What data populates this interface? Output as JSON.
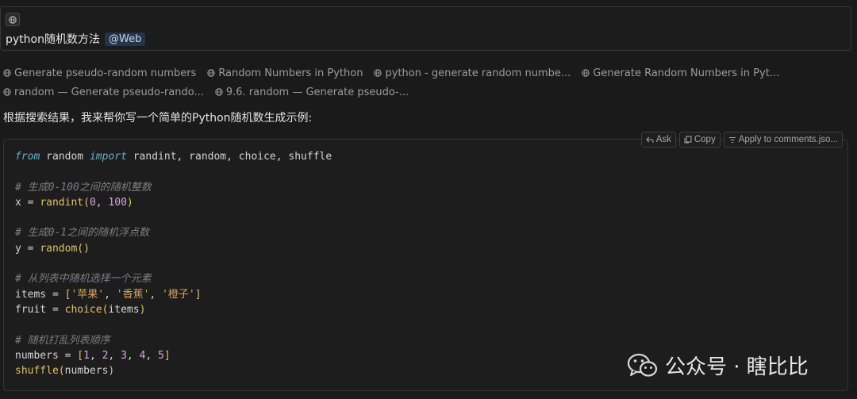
{
  "query": {
    "text": "python随机数方法",
    "tag": "@Web"
  },
  "sources": [
    [
      "Generate pseudo-random numbers",
      "Random Numbers in Python",
      "python - generate random numbe...",
      "Generate Random Numbers in Pyt..."
    ],
    [
      "random — Generate pseudo-rando...",
      "9.6. random — Generate pseudo-..."
    ]
  ],
  "answer_intro": "根据搜索结果，我来帮你写一个简单的Python随机数生成示例:",
  "code_actions": {
    "ask": "Ask",
    "copy": "Copy",
    "apply": "Apply to comments.jso..."
  },
  "code": {
    "l1": [
      "from",
      "random",
      "import",
      "randint, random, choice, shuffle"
    ],
    "c1": "# 生成0-100之间的随机整数",
    "l2": [
      "x = ",
      "randint",
      "(",
      "0",
      ", ",
      "100",
      ")"
    ],
    "c2": "# 生成0-1之间的随机浮点数",
    "l3": [
      "y = ",
      "random",
      "()"
    ],
    "c3": "# 从列表中随机选择一个元素",
    "l4": [
      "items = ",
      "[",
      "'苹果'",
      ", ",
      "'香蕉'",
      ", ",
      "'橙子'",
      "]"
    ],
    "l5": [
      "fruit = ",
      "choice",
      "(",
      "items",
      ")"
    ],
    "c4": "# 随机打乱列表顺序",
    "l6": [
      "numbers = ",
      "[",
      "1",
      ", ",
      "2",
      ", ",
      "3",
      ", ",
      "4",
      ", ",
      "5",
      "]"
    ],
    "l7": [
      "shuffle",
      "(",
      "numbers",
      ")"
    ]
  },
  "watermark": "公众号 · 瞎比比",
  "icons": {
    "globe": "globe-icon",
    "ask": "undo-arrow-icon",
    "copy": "copy-icon",
    "apply": "apply-lines-icon",
    "wechat": "wechat-icon"
  }
}
